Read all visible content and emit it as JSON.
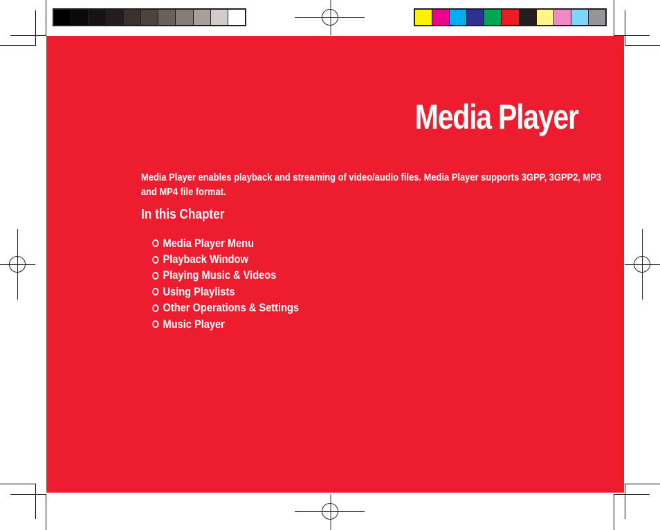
{
  "page": {
    "title": "Media Player",
    "intro": "Media Player enables playback and streaming of video/audio files. Media Player supports 3GPP, 3GPP2, MP3 and MP4 file format.",
    "chapter_heading": "In this Chapter",
    "toc": [
      {
        "label": "Media Player Menu",
        "icon": "circle-bullet-icon"
      },
      {
        "label": "Playback Window",
        "icon": "circle-bullet-icon"
      },
      {
        "label": "Playing Music & Videos",
        "icon": "circle-bullet-icon"
      },
      {
        "label": "Using Playlists",
        "icon": "circle-bullet-icon"
      },
      {
        "label": "Other Operations & Settings",
        "icon": "circle-bullet-icon"
      },
      {
        "label": "Music Player",
        "icon": "circle-bullet-icon"
      }
    ]
  },
  "colors": {
    "panel": "#ed1c2e",
    "text": "#ffffff",
    "grayscale_bar": [
      "#000000",
      "#0b0908",
      "#161312",
      "#221e1d",
      "#3a3230",
      "#4c4341",
      "#6b605d",
      "#857b78",
      "#a89f9d",
      "#d1cbca",
      "#ffffff"
    ],
    "color_bar": [
      "#fff200",
      "#ec008c",
      "#00aeef",
      "#2e3192",
      "#00a651",
      "#ed1c24",
      "#231f20",
      "#fff685",
      "#f287c5",
      "#7fd5f7",
      "#939598"
    ]
  }
}
